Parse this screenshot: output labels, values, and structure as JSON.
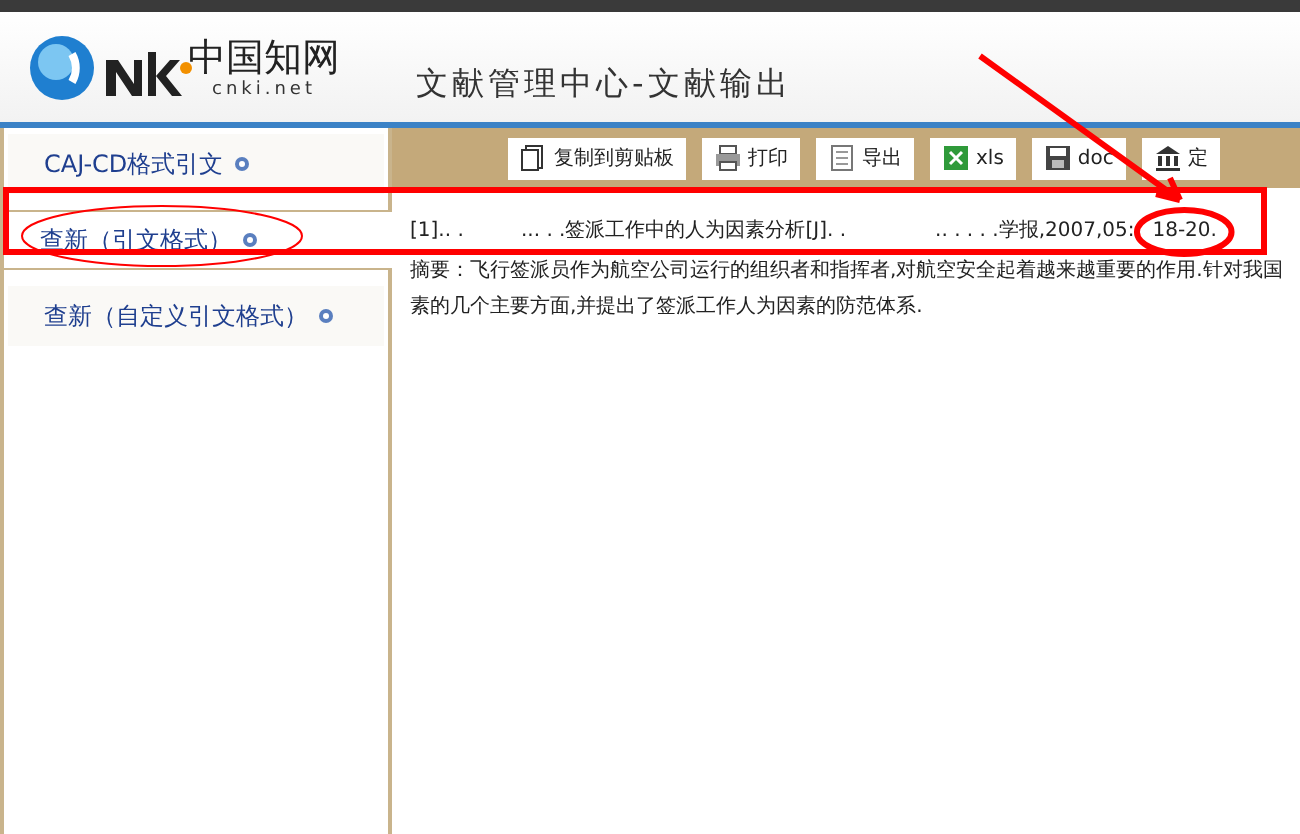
{
  "header": {
    "logo_cn": "中国知网",
    "logo_url": "cnki.net",
    "title": "文献管理中心-文献输出"
  },
  "sidebar": {
    "items": [
      {
        "label": "CAJ-CD格式引文",
        "selected": false
      },
      {
        "label": "查新（引文格式）",
        "selected": true
      },
      {
        "label": "查新（自定义引文格式）",
        "selected": false
      }
    ]
  },
  "toolbar": [
    {
      "kind": "copy",
      "label": "复制到剪贴板"
    },
    {
      "kind": "print",
      "label": "打印"
    },
    {
      "kind": "export",
      "label": "导出"
    },
    {
      "kind": "xls",
      "label": "xls"
    },
    {
      "kind": "doc",
      "label": "doc"
    },
    {
      "kind": "bank",
      "label": "定"
    }
  ],
  "citation": {
    "text": "[1].. .         ... . .签派工作中的人为因素分析[J]. .              .. . . . .学报,2007,05:",
    "pages": "18-20.",
    "abstract_label": "摘要：",
    "abstract_line1": "飞行签派员作为航空公司运行的组织者和指挥者,对航空安全起着越来越重要的作用.针对我国",
    "abstract_line2": "素的几个主要方面,并提出了签派工作人为因素的防范体系."
  }
}
